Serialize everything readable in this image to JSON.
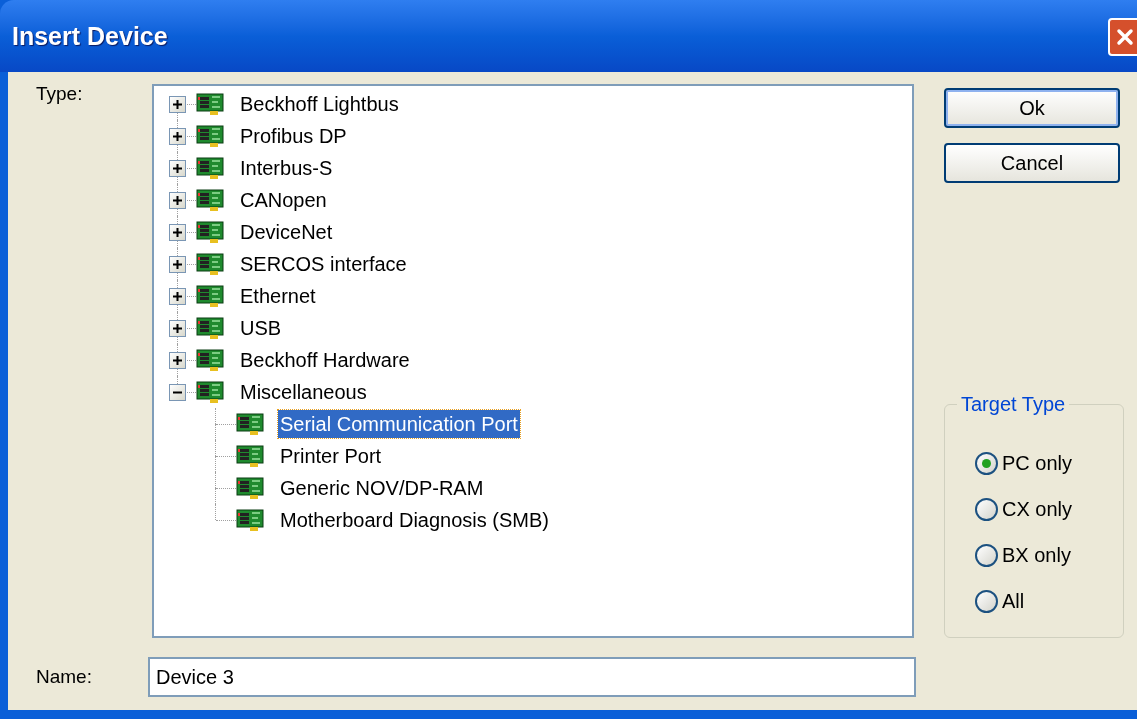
{
  "window": {
    "title": "Insert Device"
  },
  "type_label": "Type:",
  "tree": [
    {
      "label": "Beckhoff Lightbus",
      "expanded": false,
      "selected": false
    },
    {
      "label": "Profibus DP",
      "expanded": false,
      "selected": false
    },
    {
      "label": "Interbus-S",
      "expanded": false,
      "selected": false
    },
    {
      "label": "CANopen",
      "expanded": false,
      "selected": false
    },
    {
      "label": "DeviceNet",
      "expanded": false,
      "selected": false
    },
    {
      "label": "SERCOS interface",
      "expanded": false,
      "selected": false
    },
    {
      "label": "Ethernet",
      "expanded": false,
      "selected": false
    },
    {
      "label": "USB",
      "expanded": false,
      "selected": false
    },
    {
      "label": "Beckhoff Hardware",
      "expanded": false,
      "selected": false
    },
    {
      "label": "Miscellaneous",
      "expanded": true,
      "selected": false,
      "children": [
        {
          "label": "Serial Communication Port",
          "selected": true
        },
        {
          "label": "Printer Port",
          "selected": false
        },
        {
          "label": "Generic NOV/DP-RAM",
          "selected": false
        },
        {
          "label": "Motherboard Diagnosis (SMB)",
          "selected": false
        }
      ]
    }
  ],
  "buttons": [
    "Ok",
    "Cancel"
  ],
  "target_type": {
    "title": "Target Type",
    "options": [
      {
        "label": "PC only",
        "selected": true
      },
      {
        "label": "CX only",
        "selected": false
      },
      {
        "label": "BX only",
        "selected": false
      },
      {
        "label": "All",
        "selected": false
      }
    ]
  },
  "name_field": {
    "label": "Name:",
    "value": "Device 3"
  }
}
